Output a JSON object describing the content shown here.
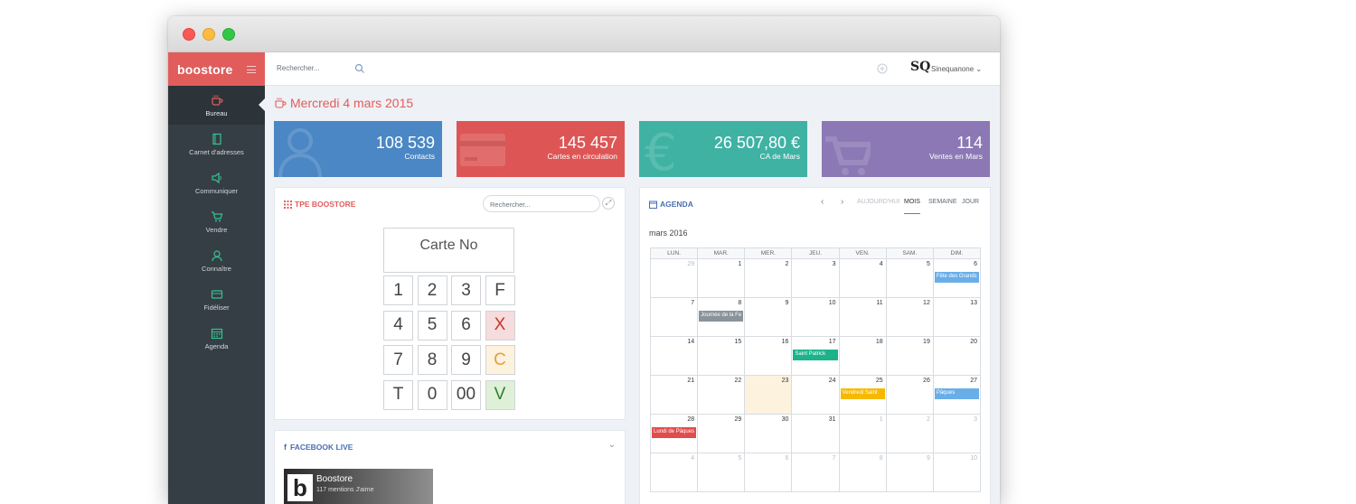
{
  "brand": {
    "name": "boostore",
    "accent": "#e05d5c"
  },
  "nav": [
    {
      "label": "Bureau",
      "icon": "coffee-cup-icon",
      "active": true
    },
    {
      "label": "Carnet d'adresses",
      "icon": "address-book-icon"
    },
    {
      "label": "Communiquer",
      "icon": "speaker-icon"
    },
    {
      "label": "Vendre",
      "icon": "cart-icon"
    },
    {
      "label": "Connaître",
      "icon": "user-icon"
    },
    {
      "label": "Fidéliser",
      "icon": "card-icon"
    },
    {
      "label": "Agenda",
      "icon": "calendar-icon"
    }
  ],
  "topbar": {
    "search_placeholder": "Rechercher...",
    "user_logo": "SQ",
    "user_name": "Sinequanone ⌄"
  },
  "page": {
    "date_title": "Mercredi 4 mars 2015"
  },
  "stats": [
    {
      "value": "108 539",
      "label": "Contacts",
      "color": "#4a87c4",
      "icon": "person-silhouette-icon"
    },
    {
      "value": "145 457",
      "label": "Cartes en circulation",
      "color": "#dd5655",
      "icon": "card-silhouette-icon"
    },
    {
      "value": "26 507,80 €",
      "label": "CA de Mars",
      "color": "#3fb2a4",
      "icon": "euro-silhouette-icon"
    },
    {
      "value": "114",
      "label": "Ventes en Mars",
      "color": "#8b78b5",
      "icon": "cart-silhouette-icon"
    }
  ],
  "tpe": {
    "title": "TPE BOOSTORE",
    "search_placeholder": "Rechercher...",
    "display": "Carte No",
    "keys": [
      [
        "1",
        "2",
        "3",
        "F"
      ],
      [
        "4",
        "5",
        "6",
        "X"
      ],
      [
        "7",
        "8",
        "9",
        "C"
      ],
      [
        "T",
        "0",
        "00",
        "V"
      ]
    ]
  },
  "agenda": {
    "title": "AGENDA",
    "prev": "‹",
    "next": "›",
    "today_label": "AUJOURD'HUI",
    "tabs": [
      "MOIS",
      "SEMAINE",
      "JOUR"
    ],
    "active_tab": "MOIS",
    "month_label": "mars 2016",
    "weekdays": [
      "LUN.",
      "MAR.",
      "MER.",
      "JEU.",
      "VEN.",
      "SAM.",
      "DIM."
    ],
    "weeks": [
      [
        {
          "d": "29",
          "m": true
        },
        {
          "d": "1"
        },
        {
          "d": "2"
        },
        {
          "d": "3"
        },
        {
          "d": "4"
        },
        {
          "d": "5"
        },
        {
          "d": "6",
          "event": "Fête des Grands",
          "color": "#6aaee8"
        }
      ],
      [
        {
          "d": "7"
        },
        {
          "d": "8",
          "event": "Journée de la Fe",
          "color": "#8a9399"
        },
        {
          "d": "9"
        },
        {
          "d": "10"
        },
        {
          "d": "11"
        },
        {
          "d": "12"
        },
        {
          "d": "13"
        }
      ],
      [
        {
          "d": "14"
        },
        {
          "d": "15"
        },
        {
          "d": "16"
        },
        {
          "d": "17",
          "event": "Saint Patrick",
          "color": "#1cb38b"
        },
        {
          "d": "18"
        },
        {
          "d": "19"
        },
        {
          "d": "20"
        }
      ],
      [
        {
          "d": "21"
        },
        {
          "d": "22"
        },
        {
          "d": "23",
          "today": true
        },
        {
          "d": "24"
        },
        {
          "d": "25",
          "event": "Vendredi Saint",
          "color": "#f6b900"
        },
        {
          "d": "26"
        },
        {
          "d": "27",
          "event": "Pâques",
          "color": "#6aaee8"
        }
      ],
      [
        {
          "d": "28",
          "event": "Lundi de Pâques",
          "color": "#e24c4b"
        },
        {
          "d": "29"
        },
        {
          "d": "30"
        },
        {
          "d": "31"
        },
        {
          "d": "1",
          "m": true
        },
        {
          "d": "2",
          "m": true
        },
        {
          "d": "3",
          "m": true
        }
      ],
      [
        {
          "d": "4",
          "m": true
        },
        {
          "d": "5",
          "m": true
        },
        {
          "d": "6",
          "m": true
        },
        {
          "d": "7",
          "m": true
        },
        {
          "d": "8",
          "m": true
        },
        {
          "d": "9",
          "m": true
        },
        {
          "d": "10",
          "m": true
        }
      ]
    ]
  },
  "facebook": {
    "title": "FACEBOOK LIVE",
    "page_name": "Boostore",
    "page_sub": "117 mentions J'aime",
    "logo": "b"
  }
}
